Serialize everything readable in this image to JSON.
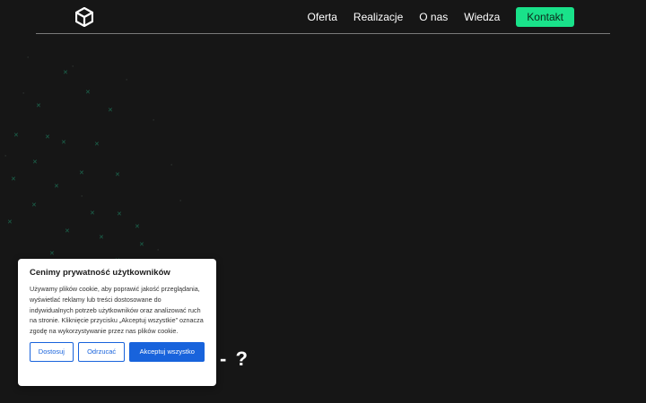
{
  "nav": {
    "logo_icon": "cube-logo-icon",
    "items": [
      {
        "label": "Oferta"
      },
      {
        "label": "Realizacje"
      },
      {
        "label": "O nas"
      },
      {
        "label": "Wiedza"
      }
    ],
    "contact_label": "Kontakt",
    "accent_color": "#19e28a"
  },
  "hero": {
    "visible_partial_text": "- ?"
  },
  "cookie_banner": {
    "title": "Cenimy prywatność użytkowników",
    "body": "Używamy plików cookie, aby poprawić jakość przeglądania, wyświetlać reklamy lub treści dostosowane do indywidualnych potrzeb użytkowników oraz analizować ruch na stronie. Kliknięcie przycisku „Akceptuj wszystkie” oznacza zgodę na wykorzystywanie przez nas plików cookie.",
    "customize_label": "Dostosuj",
    "reject_label": "Odrzucać",
    "accept_label": "Akceptuj wszystko",
    "button_color": "#1863dc"
  }
}
